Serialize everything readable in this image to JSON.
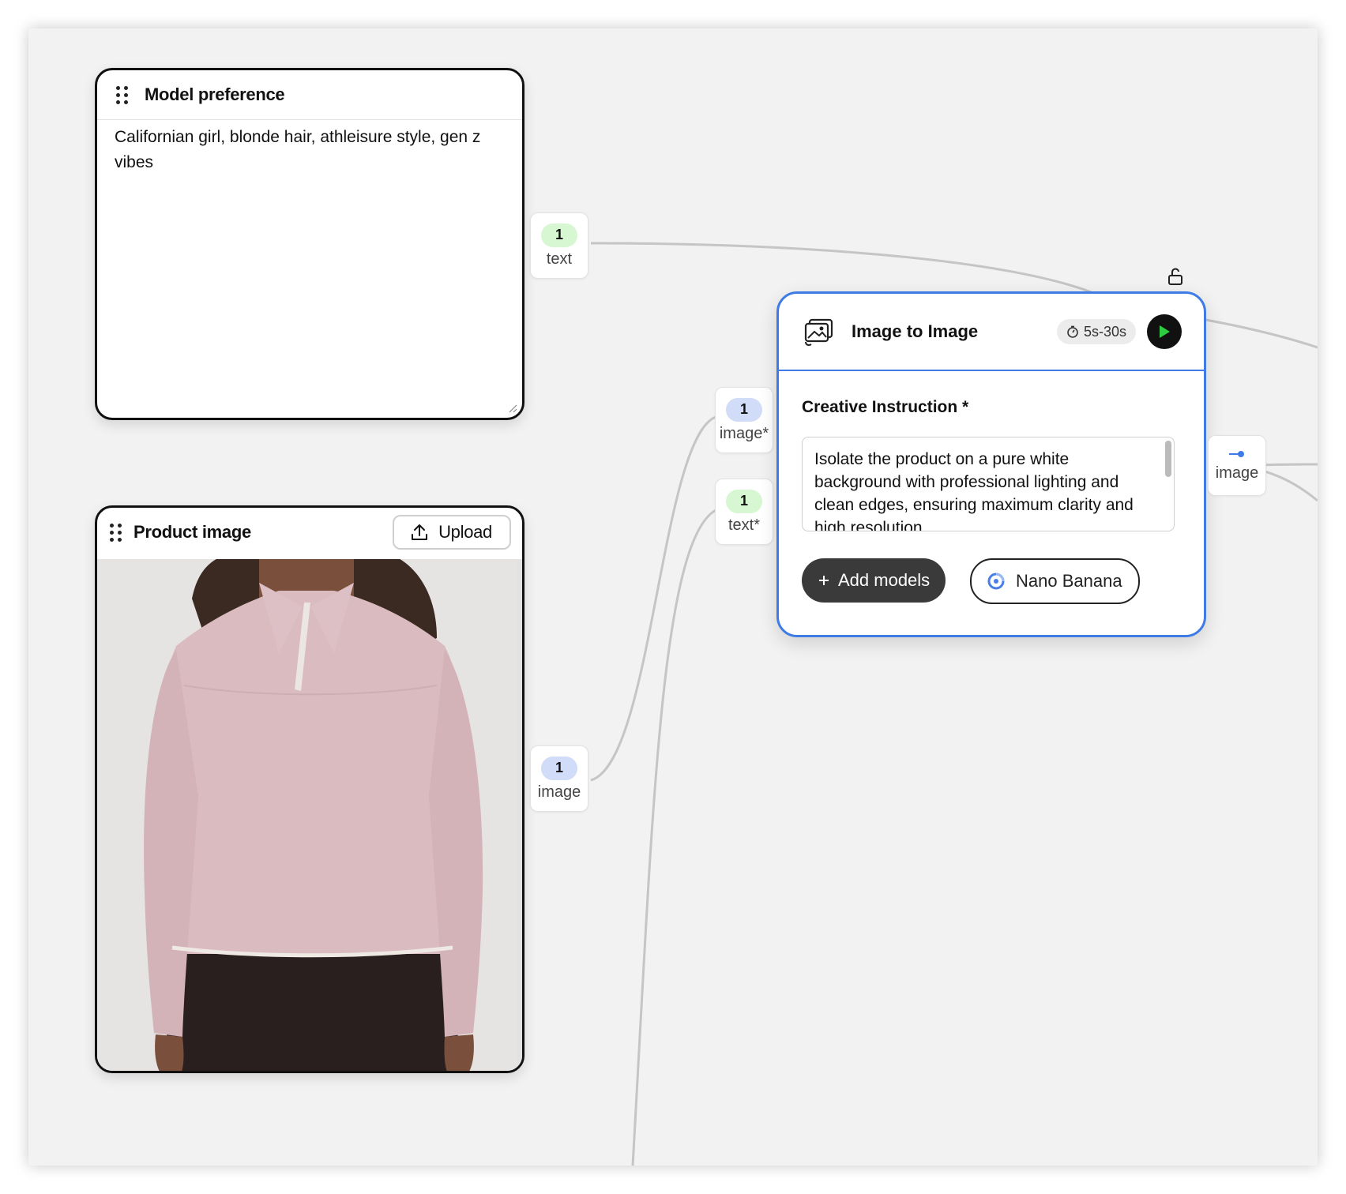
{
  "nodes": {
    "model_preference": {
      "title": "Model preference",
      "value": "Californian girl, blonde hair, athleisure style, gen z vibes",
      "output_port": {
        "count": "1",
        "label": "text"
      }
    },
    "product_image": {
      "title": "Product image",
      "upload_label": "Upload",
      "output_port": {
        "count": "1",
        "label": "image"
      }
    },
    "image_to_image": {
      "title": "Image to Image",
      "duration": "5s-30s",
      "field_label": "Creative Instruction *",
      "instruction": "Isolate the product on a pure white background with professional lighting and clean edges, ensuring maximum clarity and high resolution.",
      "add_models_label": "Add models",
      "model_name": "Nano Banana",
      "inputs": [
        {
          "count": "1",
          "label": "image*"
        },
        {
          "count": "1",
          "label": "text*"
        }
      ],
      "output_label": "image"
    }
  },
  "colors": {
    "canvas": "#f2f2f2",
    "selected_border": "#3e7be6",
    "text_pill": "#d6f7d1",
    "image_pill": "#d0dcf8",
    "run_icon": "#2ecc40"
  },
  "icons": [
    "drag-handle-icon",
    "upload-icon",
    "image-to-image-icon",
    "timer-icon",
    "play-icon",
    "plus-icon",
    "google-gemini-icon",
    "unlock-icon",
    "output-connector-icon",
    "resize-grip-icon"
  ]
}
